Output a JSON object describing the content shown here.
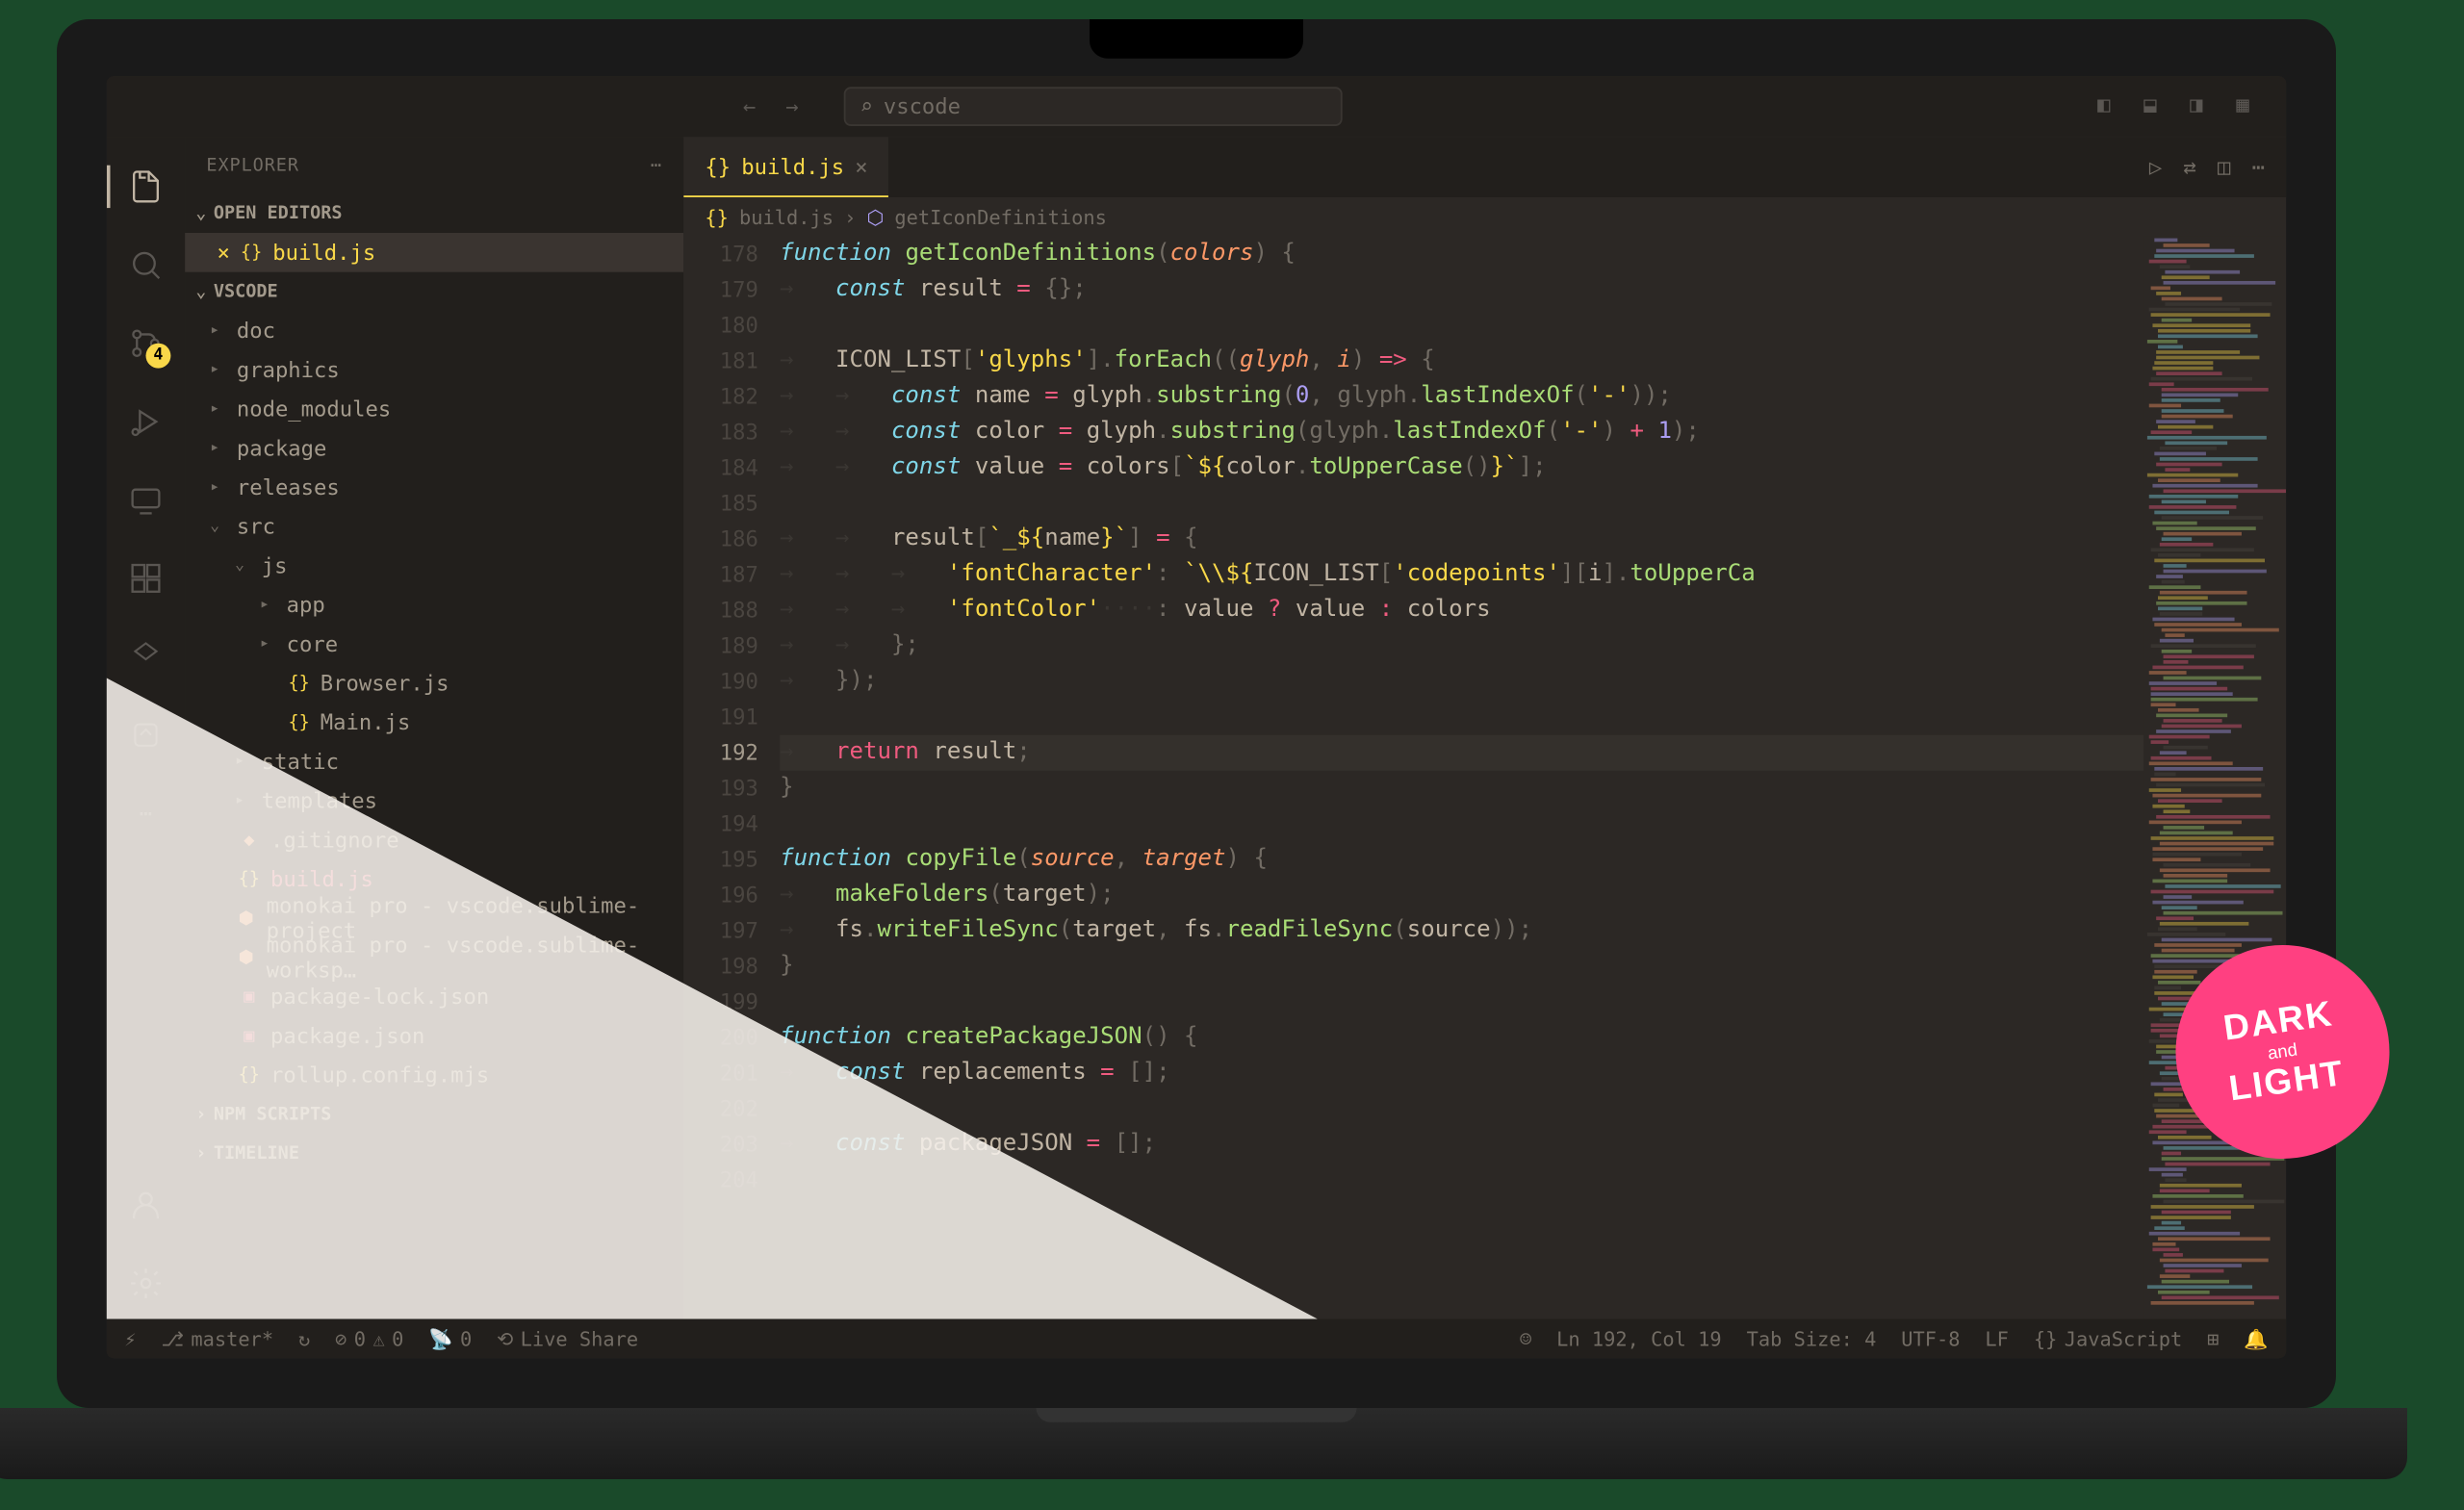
{
  "titlebar": {
    "search_text": "vscode"
  },
  "sidebar": {
    "title": "EXPLORER",
    "open_editors_label": "OPEN EDITORS",
    "open_editor_file": "build.js",
    "workspace_name": "VSCODE",
    "npm_scripts_label": "NPM SCRIPTS",
    "timeline_label": "TIMELINE",
    "tree": [
      {
        "name": "doc",
        "type": "folder",
        "depth": 0,
        "expanded": false
      },
      {
        "name": "graphics",
        "type": "folder",
        "depth": 0,
        "expanded": false
      },
      {
        "name": "node_modules",
        "type": "folder",
        "depth": 0,
        "expanded": false
      },
      {
        "name": "package",
        "type": "folder",
        "depth": 0,
        "expanded": false
      },
      {
        "name": "releases",
        "type": "folder",
        "depth": 0,
        "expanded": false
      },
      {
        "name": "src",
        "type": "folder",
        "depth": 0,
        "expanded": true
      },
      {
        "name": "js",
        "type": "folder",
        "depth": 1,
        "expanded": true
      },
      {
        "name": "app",
        "type": "folder",
        "depth": 2,
        "expanded": false
      },
      {
        "name": "core",
        "type": "folder",
        "depth": 2,
        "expanded": false
      },
      {
        "name": "Browser.js",
        "type": "js",
        "depth": 2
      },
      {
        "name": "Main.js",
        "type": "js",
        "depth": 2
      },
      {
        "name": "static",
        "type": "folder",
        "depth": 1,
        "expanded": false
      },
      {
        "name": "templates",
        "type": "folder",
        "depth": 1,
        "expanded": false
      },
      {
        "name": ".gitignore",
        "type": "git",
        "depth": 0
      },
      {
        "name": "build.js",
        "type": "js",
        "depth": 0,
        "modified": true
      },
      {
        "name": "monokai pro - vscode.sublime-project",
        "type": "sublime",
        "depth": 0
      },
      {
        "name": "monokai pro - vscode.sublime-worksp…",
        "type": "sublime",
        "depth": 0
      },
      {
        "name": "package-lock.json",
        "type": "json",
        "depth": 0
      },
      {
        "name": "package.json",
        "type": "json",
        "depth": 0
      },
      {
        "name": "rollup.config.mjs",
        "type": "js",
        "depth": 0
      }
    ]
  },
  "activity_badge": "4",
  "tab": {
    "label": "build.js"
  },
  "breadcrumb": {
    "file": "build.js",
    "symbol": "getIconDefinitions"
  },
  "code": {
    "first_line": 178,
    "current_line": 192,
    "lines": [
      {
        "n": 178,
        "tokens": [
          [
            "kw-it",
            "function"
          ],
          [
            "var",
            " "
          ],
          [
            "fn",
            "getIconDefinitions"
          ],
          [
            "punc",
            "("
          ],
          [
            "param",
            "colors"
          ],
          [
            "punc",
            ") "
          ],
          [
            "punc",
            "{"
          ]
        ]
      },
      {
        "n": 179,
        "tokens": [
          [
            "ws",
            "→   "
          ],
          [
            "kw-it",
            "const"
          ],
          [
            "var",
            " "
          ],
          [
            "var",
            "result"
          ],
          [
            "op",
            " = "
          ],
          [
            "punc",
            "{};"
          ]
        ]
      },
      {
        "n": 180,
        "tokens": []
      },
      {
        "n": 181,
        "tokens": [
          [
            "ws",
            "→   "
          ],
          [
            "var",
            "ICON_LIST"
          ],
          [
            "punc",
            "["
          ],
          [
            "str",
            "'glyphs'"
          ],
          [
            "punc",
            "]."
          ],
          [
            "fn",
            "forEach"
          ],
          [
            "punc",
            "(("
          ],
          [
            "param",
            "glyph"
          ],
          [
            "punc",
            ", "
          ],
          [
            "param",
            "i"
          ],
          [
            "punc",
            ") "
          ],
          [
            "op",
            "=>"
          ],
          [
            "punc",
            " {"
          ]
        ]
      },
      {
        "n": 182,
        "tokens": [
          [
            "ws",
            "→   →   "
          ],
          [
            "kw-it",
            "const"
          ],
          [
            "var",
            " name "
          ],
          [
            "op",
            "="
          ],
          [
            "var",
            " glyph"
          ],
          [
            "punc",
            "."
          ],
          [
            "fn",
            "substring"
          ],
          [
            "punc",
            "("
          ],
          [
            "num",
            "0"
          ],
          [
            "punc",
            ", glyph."
          ],
          [
            "fn",
            "lastIndexOf"
          ],
          [
            "punc",
            "("
          ],
          [
            "str",
            "'-'"
          ],
          [
            "punc",
            "));"
          ]
        ]
      },
      {
        "n": 183,
        "tokens": [
          [
            "ws",
            "→   →   "
          ],
          [
            "kw-it",
            "const"
          ],
          [
            "var",
            " color "
          ],
          [
            "op",
            "="
          ],
          [
            "var",
            " glyph"
          ],
          [
            "punc",
            "."
          ],
          [
            "fn",
            "substring"
          ],
          [
            "punc",
            "(glyph."
          ],
          [
            "fn",
            "lastIndexOf"
          ],
          [
            "punc",
            "("
          ],
          [
            "str",
            "'-'"
          ],
          [
            "punc",
            ") "
          ],
          [
            "op",
            "+"
          ],
          [
            "punc",
            " "
          ],
          [
            "num",
            "1"
          ],
          [
            "punc",
            ");"
          ]
        ]
      },
      {
        "n": 184,
        "tokens": [
          [
            "ws",
            "→   →   "
          ],
          [
            "kw-it",
            "const"
          ],
          [
            "var",
            " value "
          ],
          [
            "op",
            "="
          ],
          [
            "var",
            " colors"
          ],
          [
            "punc",
            "["
          ],
          [
            "str",
            "`${"
          ],
          [
            "var",
            "color"
          ],
          [
            "punc",
            "."
          ],
          [
            "fn",
            "toUpperCase"
          ],
          [
            "punc",
            "()"
          ],
          [
            "str",
            "}`"
          ],
          [
            "punc",
            "];"
          ]
        ]
      },
      {
        "n": 185,
        "tokens": []
      },
      {
        "n": 186,
        "tokens": [
          [
            "ws",
            "→   →   "
          ],
          [
            "var",
            "result"
          ],
          [
            "punc",
            "["
          ],
          [
            "str",
            "`_${"
          ],
          [
            "var",
            "name"
          ],
          [
            "str",
            "}`"
          ],
          [
            "punc",
            "] "
          ],
          [
            "op",
            "="
          ],
          [
            "punc",
            " {"
          ]
        ]
      },
      {
        "n": 187,
        "tokens": [
          [
            "ws",
            "→   →   →   "
          ],
          [
            "str",
            "'fontCharacter'"
          ],
          [
            "punc",
            ": "
          ],
          [
            "str",
            "`\\\\${"
          ],
          [
            "var",
            "ICON_LIST"
          ],
          [
            "punc",
            "["
          ],
          [
            "str",
            "'codepoints'"
          ],
          [
            "punc",
            "]["
          ],
          [
            "var",
            "i"
          ],
          [
            "punc",
            "]."
          ],
          [
            "fn",
            "toUpperCa"
          ]
        ]
      },
      {
        "n": 188,
        "tokens": [
          [
            "ws",
            "→   →   →   "
          ],
          [
            "str",
            "'fontColor'"
          ],
          [
            "ws",
            "····"
          ],
          [
            "punc",
            ": "
          ],
          [
            "var",
            "value "
          ],
          [
            "op",
            "?"
          ],
          [
            "var",
            " value "
          ],
          [
            "op",
            ":"
          ],
          [
            "var",
            " colors"
          ]
        ]
      },
      {
        "n": 189,
        "tokens": [
          [
            "ws",
            "→   →   "
          ],
          [
            "punc",
            "};"
          ]
        ]
      },
      {
        "n": 190,
        "tokens": [
          [
            "ws",
            "→   "
          ],
          [
            "punc",
            "});"
          ]
        ]
      },
      {
        "n": 191,
        "tokens": []
      },
      {
        "n": 192,
        "hl": true,
        "tokens": [
          [
            "ws",
            "→   "
          ],
          [
            "kw",
            "return"
          ],
          [
            "var",
            " result"
          ],
          [
            "punc",
            ";"
          ]
        ]
      },
      {
        "n": 193,
        "tokens": [
          [
            "punc",
            "}"
          ]
        ]
      },
      {
        "n": 194,
        "tokens": []
      },
      {
        "n": 195,
        "tokens": [
          [
            "kw-it",
            "function"
          ],
          [
            "var",
            " "
          ],
          [
            "fn",
            "copyFile"
          ],
          [
            "punc",
            "("
          ],
          [
            "param",
            "source"
          ],
          [
            "punc",
            ", "
          ],
          [
            "param",
            "target"
          ],
          [
            "punc",
            ") {"
          ]
        ]
      },
      {
        "n": 196,
        "tokens": [
          [
            "ws",
            "→   "
          ],
          [
            "fn",
            "makeFolders"
          ],
          [
            "punc",
            "("
          ],
          [
            "var",
            "target"
          ],
          [
            "punc",
            ");"
          ]
        ]
      },
      {
        "n": 197,
        "tokens": [
          [
            "ws",
            "→   "
          ],
          [
            "var",
            "fs"
          ],
          [
            "punc",
            "."
          ],
          [
            "fn",
            "writeFileSync"
          ],
          [
            "punc",
            "("
          ],
          [
            "var",
            "target"
          ],
          [
            "punc",
            ", "
          ],
          [
            "var",
            "fs"
          ],
          [
            "punc",
            "."
          ],
          [
            "fn",
            "readFileSync"
          ],
          [
            "punc",
            "("
          ],
          [
            "var",
            "source"
          ],
          [
            "punc",
            "));"
          ]
        ]
      },
      {
        "n": 198,
        "tokens": [
          [
            "punc",
            "}"
          ]
        ]
      },
      {
        "n": 199,
        "tokens": []
      },
      {
        "n": 200,
        "tokens": [
          [
            "kw-it",
            "function"
          ],
          [
            "var",
            " "
          ],
          [
            "fn",
            "createPackageJSON"
          ],
          [
            "punc",
            "() {"
          ]
        ]
      },
      {
        "n": 201,
        "tokens": [
          [
            "ws",
            "→   "
          ],
          [
            "kw-it",
            "const"
          ],
          [
            "var",
            " "
          ],
          [
            "var",
            "replacements"
          ],
          [
            "op",
            " = "
          ],
          [
            "punc",
            "[];"
          ]
        ]
      },
      {
        "n": 202,
        "tokens": []
      },
      {
        "n": 203,
        "tokens": [
          [
            "ws",
            "→   "
          ],
          [
            "kw-it",
            "const"
          ],
          [
            "var",
            " "
          ],
          [
            "var",
            "packageJSON"
          ],
          [
            "op",
            " = "
          ],
          [
            "punc",
            "[];"
          ]
        ]
      },
      {
        "n": 204,
        "tokens": []
      }
    ]
  },
  "statusbar": {
    "branch": "master*",
    "errors": "0",
    "warnings": "0",
    "ports": "0",
    "live_share": "Live Share",
    "position": "Ln 192, Col 19",
    "tab_size": "Tab Size: 4",
    "encoding": "UTF-8",
    "eol": "LF",
    "language": "JavaScript"
  },
  "badge": {
    "line1": "DARK",
    "line2": "and",
    "line3": "LIGHT"
  }
}
